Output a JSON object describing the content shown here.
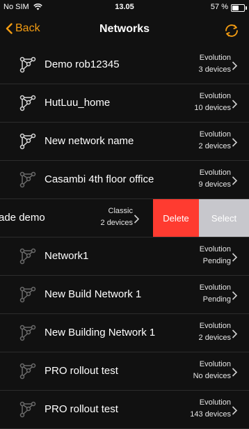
{
  "status_bar": {
    "carrier": "No SIM",
    "time": "13.05",
    "battery": "57 %",
    "battery_level_fraction": 0.57
  },
  "nav": {
    "back_label": "Back",
    "title": "Networks",
    "refresh_icon": "refresh-icon"
  },
  "colors": {
    "accent": "#f39c12",
    "background": "#111111",
    "delete": "#ff3b30",
    "select": "#c7c7cc"
  },
  "networks": [
    {
      "name": "Demo rob12345",
      "type": "Evolution",
      "devices": "3 devices"
    },
    {
      "name": "HutLuu_home",
      "type": "Evolution",
      "devices": "10 devices"
    },
    {
      "name": "New network name",
      "type": "Evolution",
      "devices": "2 devices"
    },
    {
      "name": "Casambi 4th floor office",
      "type": "Evolution",
      "devices": "9 devices"
    },
    {
      "name": "ade demo",
      "type": "Classic",
      "devices": "2 devices"
    },
    {
      "name": "Network1",
      "type": "Evolution",
      "devices": "Pending"
    },
    {
      "name": "New Build Network 1",
      "type": "Evolution",
      "devices": "Pending"
    },
    {
      "name": "New Building Network 1",
      "type": "Evolution",
      "devices": "2 devices"
    },
    {
      "name": "PRO rollout test",
      "type": "Evolution",
      "devices": "No devices"
    },
    {
      "name": "PRO rollout test",
      "type": "Evolution",
      "devices": "143 devices"
    }
  ],
  "swipe_actions": {
    "delete_label": "Delete",
    "select_label": "Select"
  }
}
